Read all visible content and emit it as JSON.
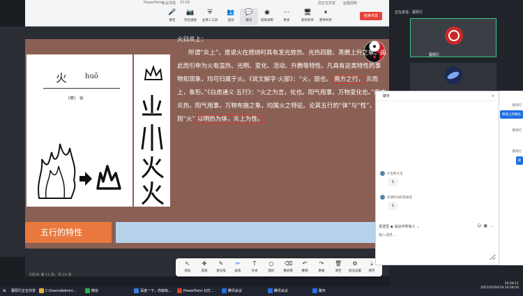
{
  "meeting": {
    "app_label": "PowerPoint",
    "info_label": "会议详情",
    "time": "37:55",
    "share_label": "您正在共享",
    "remote_label": "远程控制",
    "end_share_label": "结束共享"
  },
  "toolbar_items": [
    {
      "name": "mute",
      "label": "静音",
      "icon": "mic-icon"
    },
    {
      "name": "video",
      "label": "开启视频",
      "icon": "camera-icon"
    },
    {
      "name": "host",
      "label": "主持人工具",
      "icon": "shield-icon"
    },
    {
      "name": "members",
      "label": "成员",
      "icon": "people-icon"
    },
    {
      "name": "chat",
      "label": "聊天",
      "icon": "chat-icon"
    },
    {
      "name": "record",
      "label": "结束录制",
      "icon": "record-icon"
    },
    {
      "name": "more",
      "label": "更多",
      "icon": "more-icon"
    },
    {
      "name": "new-share",
      "label": "新的共享",
      "icon": "monitor-icon"
    },
    {
      "name": "pause-share",
      "label": "暂停共享",
      "icon": "pause-icon"
    }
  ],
  "slide": {
    "dict_char": "火",
    "dict_pinyin": "huǒ",
    "dict_note": "〔甲〕 伙",
    "heading": "火曰炎上：",
    "para_1": "所谓“炎上”，是说火在燃烧时具有发光放热、光热四散、蒸腾上升之象。由此而引申为火有温热、光明、变化、活动、升腾等特性。凡具有这类特性的事物和现象，均可归属于火。《说文解字·火部》：“火，毁也。",
    "hl_1": "南方之行，",
    "para_2": "炎而上，象形。”《白虎通义·五行》：“火之为言，化也。阳气用事，万物变化也。”南方炎热，阳气用事，万物布施之象，均属火之特征。论其五行的“体”与“性”，则“火”",
    "hl_2": "以明热为体，炎上为性。",
    "banner": "五行的特性"
  },
  "ppt_status": "幻灯片 第 11 张，共 23 张",
  "annot_items": [
    {
      "name": "mouse",
      "label": "鼠标",
      "icon": "cursor-icon"
    },
    {
      "name": "select",
      "label": "选择",
      "icon": "move-icon"
    },
    {
      "name": "laser",
      "label": "激光笔",
      "icon": "laser-icon"
    },
    {
      "name": "pen",
      "label": "画笔",
      "icon": "pen-icon"
    },
    {
      "name": "text",
      "label": "文本",
      "icon": "text-icon"
    },
    {
      "name": "shape",
      "label": "图形",
      "icon": "circle-icon"
    },
    {
      "name": "eraser",
      "label": "橡皮擦",
      "icon": "eraser-icon"
    },
    {
      "name": "undo",
      "label": "撤销",
      "icon": "undo-icon"
    },
    {
      "name": "redo",
      "label": "重做",
      "icon": "redo-icon"
    },
    {
      "name": "clear",
      "label": "清空",
      "icon": "trash-icon"
    },
    {
      "name": "settings",
      "label": "批注设置",
      "icon": "gear-icon"
    },
    {
      "name": "save",
      "label": "保存",
      "icon": "save-icon"
    }
  ],
  "participants": {
    "title": "正在讲话：",
    "speaker": "蔡阳行",
    "self_name": "蔡阳行"
  },
  "chat": {
    "title": "聊天",
    "messages": [
      {
        "sender": "大宝和大宝",
        "text": "1"
      },
      {
        "sender": "华清时间的普通话",
        "text": "1"
      }
    ],
    "send_to_label": "发送至",
    "send_to_value": "会议中所有人",
    "input_placeholder": "输入消息..."
  },
  "strip": {
    "tag_1": "蔡阳行",
    "bubble_1": "和他上的概念",
    "tag_2": "蔡阳行",
    "tag_3": "蔡阳行",
    "bubble_3": "请"
  },
  "taskbar": {
    "app_1": "蔡阳行正在共享",
    "app_2": "C:\\Users\\Admini...",
    "app_3": "微信",
    "app_4": "百度一下，你就知...",
    "app_5": "PowerPoint 幻灯...",
    "app_6": "腾讯会议",
    "app_7": "腾讯会议",
    "app_8": "聊天",
    "time": "20:28:11",
    "date": "2021/05/04/19 20:28:50"
  },
  "colors": {
    "slide_bg": "#8b6054",
    "banner": "#e9793e",
    "highlight": "#d93a2f",
    "end_share": "#e8433a",
    "chat_bubble": "#1f6fe0"
  }
}
